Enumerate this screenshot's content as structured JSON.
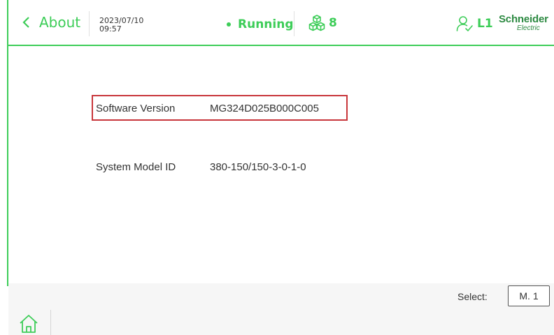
{
  "header": {
    "back_label": "About",
    "date": "2023/07/10",
    "time": "09:57",
    "status": "Running",
    "module_count": "8",
    "user_level": "L1",
    "brand_top": "Schneider",
    "brand_bottom": "Electric"
  },
  "rows": [
    {
      "label": "Software Version",
      "value": "MG324D025B000C005"
    },
    {
      "label": "System Model ID",
      "value": "380-150/150-3-0-1-0"
    }
  ],
  "footer": {
    "select_label": "Select:",
    "select_value": "M. 1"
  },
  "colors": {
    "accent": "#3dcd58",
    "highlight": "#c8363b",
    "brand": "#2d8a42"
  },
  "icons": [
    "chevron-left-icon",
    "modules-cubes-icon",
    "user-check-icon",
    "home-icon"
  ]
}
